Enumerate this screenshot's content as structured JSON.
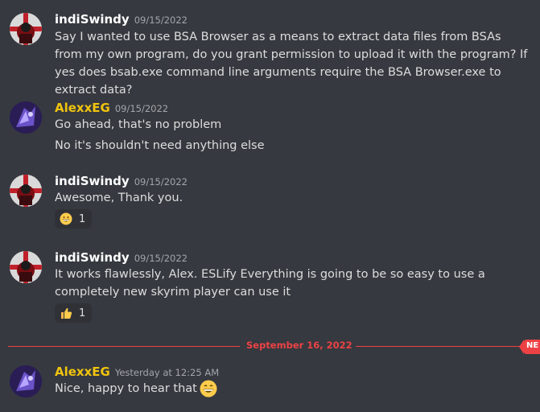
{
  "messages": [
    {
      "username": "indiSwindy",
      "timestamp": "09/15/2022",
      "lines": [
        "Say I wanted to use BSA Browser as a means to extract data files from BSAs from my own program, do you grant permission to upload it with the program? If yes does bsab.exe command line arguments require the BSA Browser.exe to extract data?"
      ]
    },
    {
      "username": "AlexxEG",
      "timestamp": "09/15/2022",
      "lines": [
        "Go ahead, that's no problem",
        "No it's shouldn't need anything else"
      ]
    },
    {
      "username": "indiSwindy",
      "timestamp": "09/15/2022",
      "lines": [
        "Awesome, Thank you."
      ],
      "reaction": {
        "emoji": "grinning-face",
        "count": "1"
      }
    },
    {
      "username": "indiSwindy",
      "timestamp": "09/15/2022",
      "lines": [
        "It works flawlessly, Alex. ESLify Everything is going to be so easy to use a completely new skyrim player can use it"
      ],
      "reaction": {
        "emoji": "thumbs-up",
        "count": "1"
      }
    },
    {
      "username": "AlexxEG",
      "timestamp": "Yesterday at 12:25 AM",
      "lines": [
        "Nice, happy to hear that"
      ],
      "inline_emoji": "grinning-face"
    }
  ],
  "divider": {
    "date": "September 16, 2022",
    "badge": "NE"
  },
  "colors": {
    "background": "#36393f",
    "text": "#dcddde",
    "timestamp": "#a3a6aa",
    "alexx_name": "#f1c40f",
    "divider": "#ed4245"
  }
}
